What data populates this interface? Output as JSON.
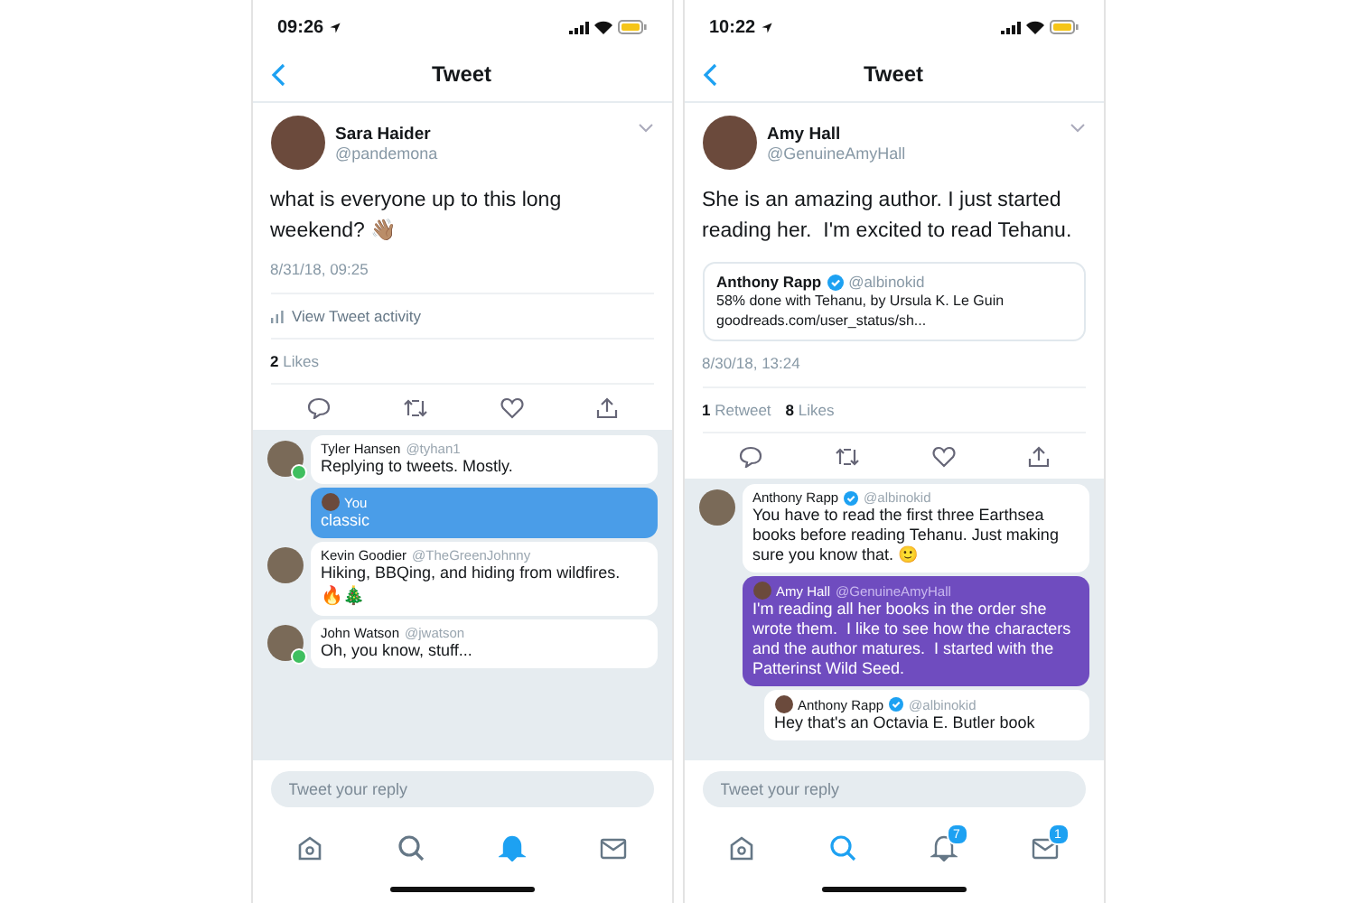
{
  "phones": [
    {
      "status_time": "09:26",
      "title": "Tweet",
      "tweet": {
        "name": "Sara Haider",
        "handle": "@pandemona",
        "text": "what is everyone up to this long weekend? 👋🏽",
        "timestamp": "8/31/18, 09:25",
        "activity": "View Tweet activity",
        "stats": [
          {
            "count": "2",
            "label": "Likes"
          }
        ]
      },
      "replies": [
        {
          "kind": "incoming",
          "name": "Tyler Hansen",
          "handle": "@tyhan1",
          "online": true,
          "text": "Replying to tweets. Mostly."
        },
        {
          "kind": "mine",
          "name": "You",
          "color": "#4a9de8",
          "text": "classic"
        },
        {
          "kind": "incoming",
          "name": "Kevin Goodier",
          "handle": "@TheGreenJohnny",
          "text": "Hiking, BBQing, and hiding from wildfires.",
          "extra": "🔥🎄"
        },
        {
          "kind": "incoming",
          "name": "John Watson",
          "handle": "@jwatson",
          "online": true,
          "text": "Oh, you know, stuff..."
        }
      ],
      "placeholder": "Tweet your reply",
      "tabs": [
        {
          "selected": false
        },
        {
          "selected": false
        },
        {
          "selected": true
        },
        {
          "selected": false
        }
      ]
    },
    {
      "status_time": "10:22",
      "title": "Tweet",
      "tweet": {
        "name": "Amy Hall",
        "handle": "@GenuineAmyHall",
        "text": "She is an amazing author. I just started reading her.  I'm excited to read Tehanu.",
        "quote": {
          "name": "Anthony Rapp",
          "handle": "@albinokid",
          "verified": true,
          "text": "58% done with Tehanu, by Ursula K. Le Guin",
          "link": "goodreads.com/user_status/sh..."
        },
        "timestamp": "8/30/18, 13:24",
        "stats": [
          {
            "count": "1",
            "label": "Retweet"
          },
          {
            "count": "8",
            "label": "Likes"
          }
        ]
      },
      "replies": [
        {
          "kind": "incoming",
          "name": "Anthony Rapp",
          "handle": "@albinokid",
          "verified": true,
          "text": "You have to read the first three Earthsea books before reading Tehanu. Just making sure you know that. 🙂"
        },
        {
          "kind": "mine",
          "name": "Amy Hall",
          "handle": "@GenuineAmyHall",
          "color": "#6f4cbf",
          "text": "I'm reading all her books in the order she wrote them.  I like to see how the characters and the author matures.  I started with the Patterinst Wild Seed."
        },
        {
          "kind": "nested",
          "name": "Anthony Rapp",
          "handle": "@albinokid",
          "verified": true,
          "text": "Hey that's an Octavia E. Butler book"
        }
      ],
      "placeholder": "Tweet your reply",
      "tabs": [
        {
          "selected": false
        },
        {
          "selected": true
        },
        {
          "selected": false,
          "badge": "7"
        },
        {
          "selected": false,
          "badge": "1"
        }
      ]
    }
  ]
}
